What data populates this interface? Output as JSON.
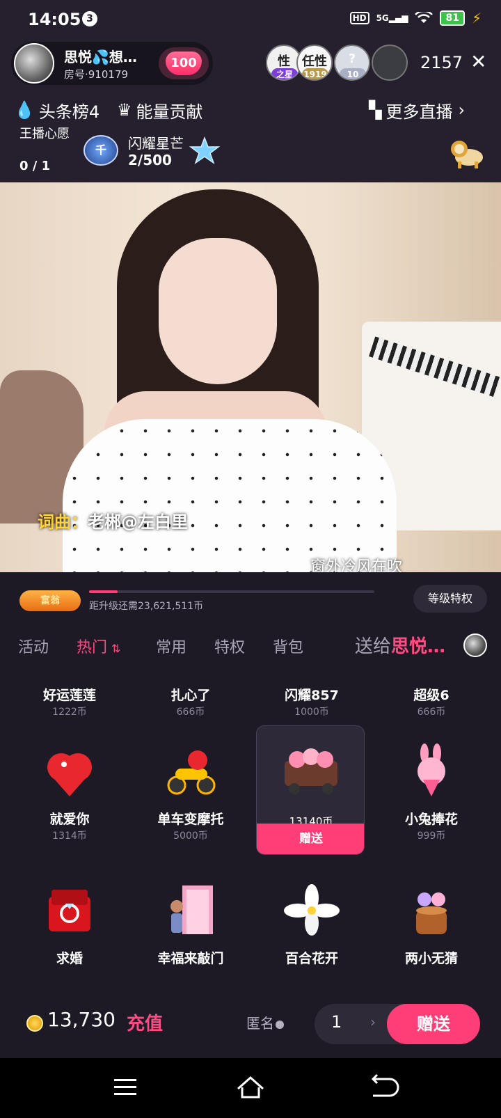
{
  "status_bar": {
    "time": "14:05",
    "notification_count": "3",
    "hd": "HD",
    "network": "5G",
    "battery": "81"
  },
  "host": {
    "name": "思悦💦想…",
    "room_no": "房号·910179",
    "heart_value": "100"
  },
  "viewers": {
    "badges": [
      "之星",
      "1919",
      "10"
    ],
    "avatar_texts": [
      "性",
      "任性"
    ],
    "count": "2157"
  },
  "top_links": {
    "rank": "头条榜4",
    "energy": "能量贡献",
    "more_live": "更多直播"
  },
  "wish": {
    "title": "王播心愿",
    "progress": "0 / 1",
    "medal_text": "千"
  },
  "star": {
    "title": "闪耀星芒",
    "progress": "2/500"
  },
  "video": {
    "credit_label": "词曲：",
    "credit_value": "老郴@左白里",
    "lyric": "窗外冷风在吹"
  },
  "level": {
    "badge": "富翁",
    "progress_text": "距升级还需23,621,511币",
    "progress_fraction": 0.1,
    "privilege_button": "等级特权"
  },
  "tabs": {
    "items": [
      "活动",
      "热门",
      "常用",
      "特权",
      "背包"
    ],
    "active_index": 1,
    "send_to_label": "送给",
    "send_to_name": "思悦…"
  },
  "gifts": {
    "row0": [
      {
        "name": "好运莲莲",
        "price": "1222币"
      },
      {
        "name": "扎心了",
        "price": "666币"
      },
      {
        "name": "闪耀857",
        "price": "1000币"
      },
      {
        "name": "超级6",
        "price": "666币"
      }
    ],
    "row1": [
      {
        "name": "就爱你",
        "price": "1314币"
      },
      {
        "name": "单车变摩托",
        "price": "5000币"
      },
      {
        "name": "",
        "price": "13140币",
        "send": "赠送"
      },
      {
        "name": "小兔捧花",
        "price": "999币"
      }
    ],
    "row2": [
      {
        "name": "求婚",
        "price": ""
      },
      {
        "name": "幸福来敲门",
        "price": ""
      },
      {
        "name": "百合花开",
        "price": ""
      },
      {
        "name": "两小无猜",
        "price": ""
      }
    ]
  },
  "bottom": {
    "balance": "13,730",
    "recharge": "充值",
    "anonymous": "匿名",
    "quantity": "1",
    "send": "赠送"
  },
  "colors": {
    "accent": "#ff3d76",
    "panel_bg": "#1d1a26",
    "top_bg": "#251f2e"
  }
}
